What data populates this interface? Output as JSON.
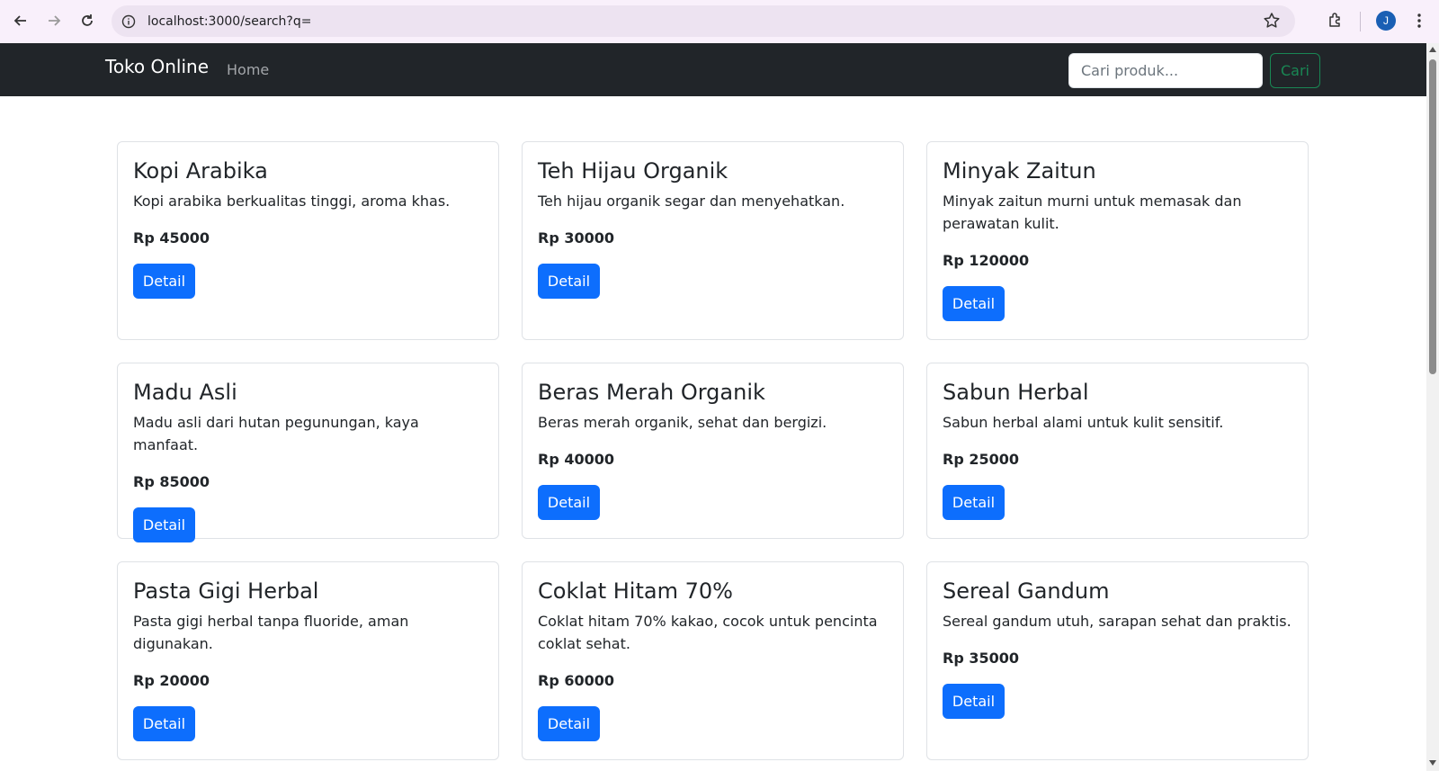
{
  "browser": {
    "url": "localhost:3000/search?q=",
    "avatar_initial": "J"
  },
  "navbar": {
    "brand": "Toko Online",
    "home_label": "Home",
    "search_placeholder": "Cari produk...",
    "search_button": "Cari"
  },
  "products": [
    {
      "name": "Kopi Arabika",
      "description": "Kopi arabika berkualitas tinggi, aroma khas.",
      "price": "Rp 45000",
      "button": "Detail"
    },
    {
      "name": "Teh Hijau Organik",
      "description": "Teh hijau organik segar dan menyehatkan.",
      "price": "Rp 30000",
      "button": "Detail"
    },
    {
      "name": "Minyak Zaitun",
      "description": "Minyak zaitun murni untuk memasak dan perawatan kulit.",
      "price": "Rp 120000",
      "button": "Detail"
    },
    {
      "name": "Madu Asli",
      "description": "Madu asli dari hutan pegunungan, kaya manfaat.",
      "price": "Rp 85000",
      "button": "Detail"
    },
    {
      "name": "Beras Merah Organik",
      "description": "Beras merah organik, sehat dan bergizi.",
      "price": "Rp 40000",
      "button": "Detail"
    },
    {
      "name": "Sabun Herbal",
      "description": "Sabun herbal alami untuk kulit sensitif.",
      "price": "Rp 25000",
      "button": "Detail"
    },
    {
      "name": "Pasta Gigi Herbal",
      "description": "Pasta gigi herbal tanpa fluoride, aman digunakan.",
      "price": "Rp 20000",
      "button": "Detail"
    },
    {
      "name": "Coklat Hitam 70%",
      "description": "Coklat hitam 70% kakao, cocok untuk pencinta coklat sehat.",
      "price": "Rp 60000",
      "button": "Detail"
    },
    {
      "name": "Sereal Gandum",
      "description": "Sereal gandum utuh, sarapan sehat dan praktis.",
      "price": "Rp 35000",
      "button": "Detail"
    }
  ],
  "colors": {
    "navbar_bg": "#212529",
    "primary": "#0d6efd",
    "success": "#198754"
  }
}
